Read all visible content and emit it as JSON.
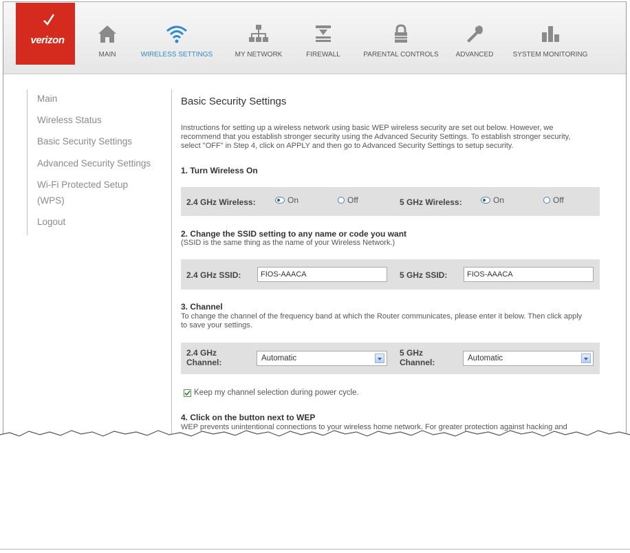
{
  "brand": {
    "name": "verizon",
    "color": "#d52b1e"
  },
  "nav": {
    "items": [
      {
        "label": "MAIN",
        "icon": "home-icon"
      },
      {
        "label": "WIRELESS SETTINGS",
        "icon": "wifi-icon",
        "active": true
      },
      {
        "label": "MY NETWORK",
        "icon": "network-icon"
      },
      {
        "label": "FIREWALL",
        "icon": "firewall-icon"
      },
      {
        "label": "PARENTAL CONTROLS",
        "icon": "lock-icon"
      },
      {
        "label": "ADVANCED",
        "icon": "wrench-icon"
      },
      {
        "label": "SYSTEM MONITORING",
        "icon": "bar-chart-icon"
      }
    ],
    "active_color": "#2e8bc7"
  },
  "sidebar": {
    "items": [
      {
        "label": "Main"
      },
      {
        "label": "Wireless Status"
      },
      {
        "label": "Basic Security Settings"
      },
      {
        "label": "Advanced Security Settings"
      },
      {
        "label": "Wi-Fi Protected Setup"
      },
      {
        "label": "(WPS)"
      },
      {
        "label": "Logout"
      }
    ]
  },
  "page": {
    "title": "Basic Security Settings",
    "intro": [
      "Instructions for setting up a wireless network using basic WEP wireless security are set out below. However, we",
      "recommend that you establish stronger security using the Advanced Security Settings. To establish stronger security,",
      "select \"OFF\" in Step 4, click on APPLY and then go to Advanced Security Settings to setup security."
    ],
    "step1": {
      "heading": "1. Turn Wireless On",
      "label_24": "2.4 GHz Wireless:",
      "label_5": "5 GHz Wireless:",
      "on": "On",
      "off": "Off",
      "selected_24": "On",
      "selected_5": "On"
    },
    "step2": {
      "heading": "2. Change the SSID setting to any name or code you want",
      "note": "(SSID is the same thing as the name of your Wireless Network.)",
      "label_24": "2.4 GHz SSID:",
      "label_5": "5 GHz SSID:",
      "value_24": "FIOS-AAACA",
      "value_5": "FIOS-AAACA"
    },
    "step3": {
      "heading": "3. Channel",
      "desc": [
        "To change the channel of the frequency band at which the Router communicates, please enter it below. Then click apply",
        "to save your settings."
      ],
      "label_24": [
        "2.4 GHz",
        "Channel:"
      ],
      "label_5": [
        "5 GHz",
        "Channel:"
      ],
      "value_24": "Automatic",
      "value_5": "Automatic",
      "keep_label": "Keep my channel selection during power cycle.",
      "keep_checked": true
    },
    "step4": {
      "heading": "4. Click on the button next to WEP",
      "desc": "WEP prevents unintentional connections to your wireless home network. For greater protection against hacking and"
    }
  }
}
